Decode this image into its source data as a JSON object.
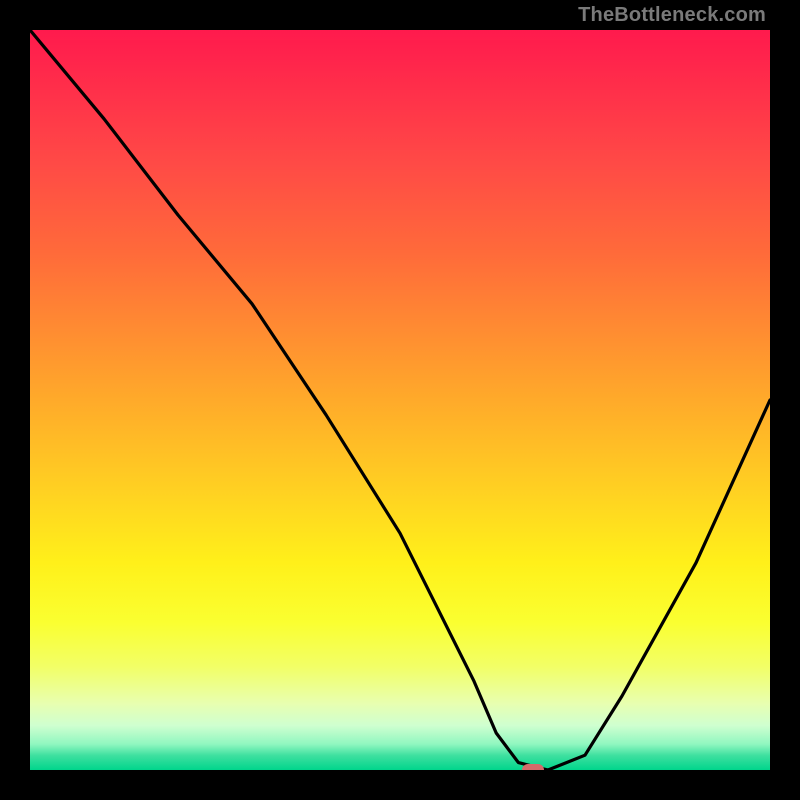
{
  "watermark": {
    "text": "TheBottleneck.com"
  },
  "chart_data": {
    "type": "line",
    "title": "",
    "xlabel": "",
    "ylabel": "",
    "xlim": [
      0,
      100
    ],
    "ylim": [
      0,
      100
    ],
    "x": [
      0,
      10,
      20,
      30,
      40,
      50,
      55,
      60,
      63,
      66,
      70,
      75,
      80,
      90,
      100
    ],
    "values": [
      100,
      88,
      75,
      63,
      48,
      32,
      22,
      12,
      5,
      1,
      0,
      2,
      10,
      28,
      50
    ],
    "series": [
      {
        "name": "bottleneck-curve",
        "x": [
          0,
          10,
          20,
          30,
          40,
          50,
          55,
          60,
          63,
          66,
          70,
          75,
          80,
          90,
          100
        ],
        "values": [
          100,
          88,
          75,
          63,
          48,
          32,
          22,
          12,
          5,
          1,
          0,
          2,
          10,
          28,
          50
        ]
      }
    ],
    "marker": {
      "x": 68,
      "y": 0
    },
    "background": {
      "type": "vertical-gradient",
      "stops": [
        {
          "pos": 0.0,
          "color": "#ff1a4d"
        },
        {
          "pos": 0.3,
          "color": "#ff6a3a"
        },
        {
          "pos": 0.6,
          "color": "#ffd022"
        },
        {
          "pos": 0.85,
          "color": "#f2ff66"
        },
        {
          "pos": 1.0,
          "color": "#00d58c"
        }
      ]
    }
  }
}
